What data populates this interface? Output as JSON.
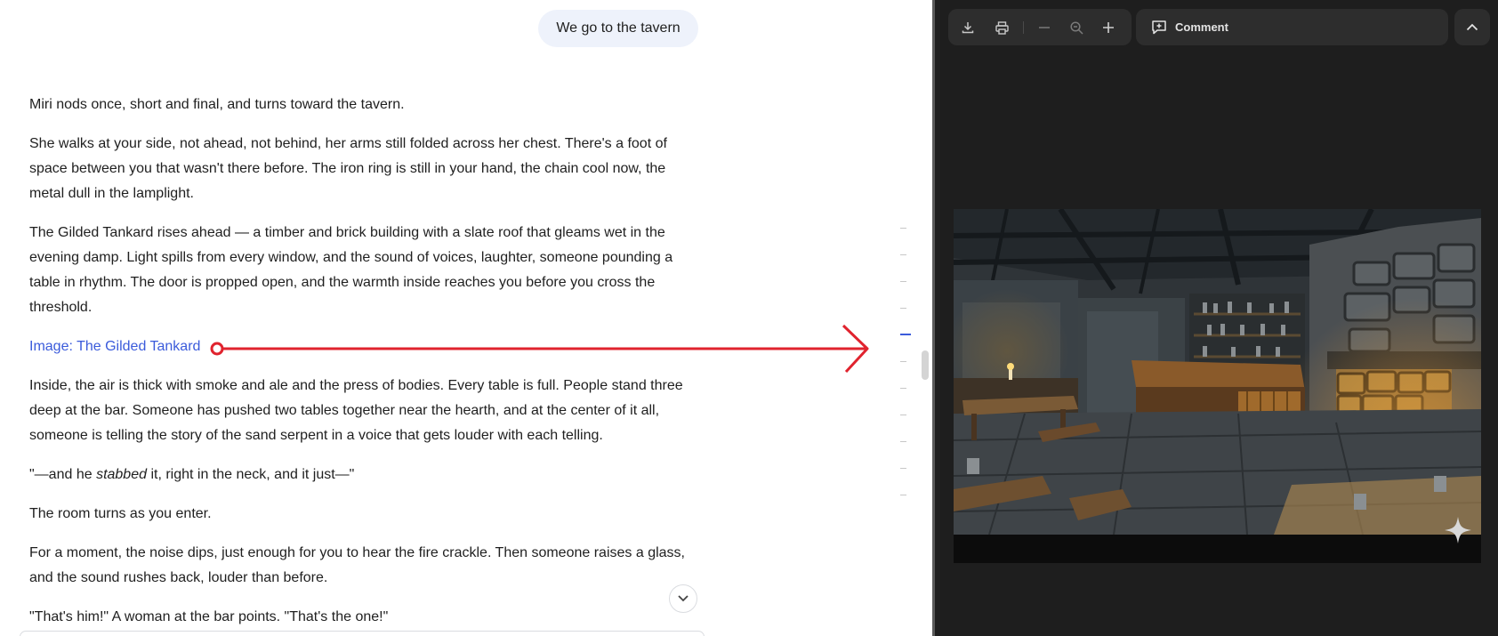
{
  "chat": {
    "user_message": "We go to the tavern",
    "paragraphs": {
      "p1": "Miri nods once, short and final, and turns toward the tavern.",
      "p2": "She walks at your side, not ahead, not behind, her arms still folded across her chest. There's a foot of space between you that wasn't there before. The iron ring is still in your hand, the chain cool now, the metal dull in the lamplight.",
      "p3": "The Gilded Tankard rises ahead — a timber and brick building with a slate roof that gleams wet in the evening damp. Light spills from every window, and the sound of voices, laughter, someone pounding a table in rhythm. The door is propped open, and the warmth inside reaches you before you cross the threshold.",
      "image_link": "Image: The Gilded Tankard",
      "p4": "Inside, the air is thick with smoke and ale and the press of bodies. Every table is full. People stand three deep at the bar. Someone has pushed two tables together near the hearth, and at the center of it all, someone is telling the story of the sand serpent in a voice that gets louder with each telling.",
      "p5_pre": "\"—and he ",
      "p5_em": "stabbed",
      "p5_post": " it, right in the neck, and it just—\"",
      "p6": "The room turns as you enter.",
      "p7": "For a moment, the noise dips, just enough for you to hear the fire crackle. Then someone raises a glass, and the sound rushes back, louder than before.",
      "p8": "\"That's him!\" A woman at the bar points. \"That's the one!\""
    },
    "scroll_down_icon": "chevron-down-icon",
    "annotation": {
      "color": "#e0232e"
    }
  },
  "viewer": {
    "toolbar": {
      "download_icon": "download-icon",
      "print_icon": "print-icon",
      "zoom_out_icon": "minus-icon",
      "zoom_icon": "zoom-icon",
      "zoom_in_icon": "plus-icon",
      "comment_label": "Comment",
      "collapse_icon": "chevron-up-icon"
    },
    "sparkle_icon": "sparkle-icon"
  },
  "colors": {
    "accent_link": "#3b5bdb",
    "viewer_bg": "#1e1e1e",
    "toolbar_bg": "#2d2d2d",
    "user_bubble_bg": "#eef2fb"
  }
}
